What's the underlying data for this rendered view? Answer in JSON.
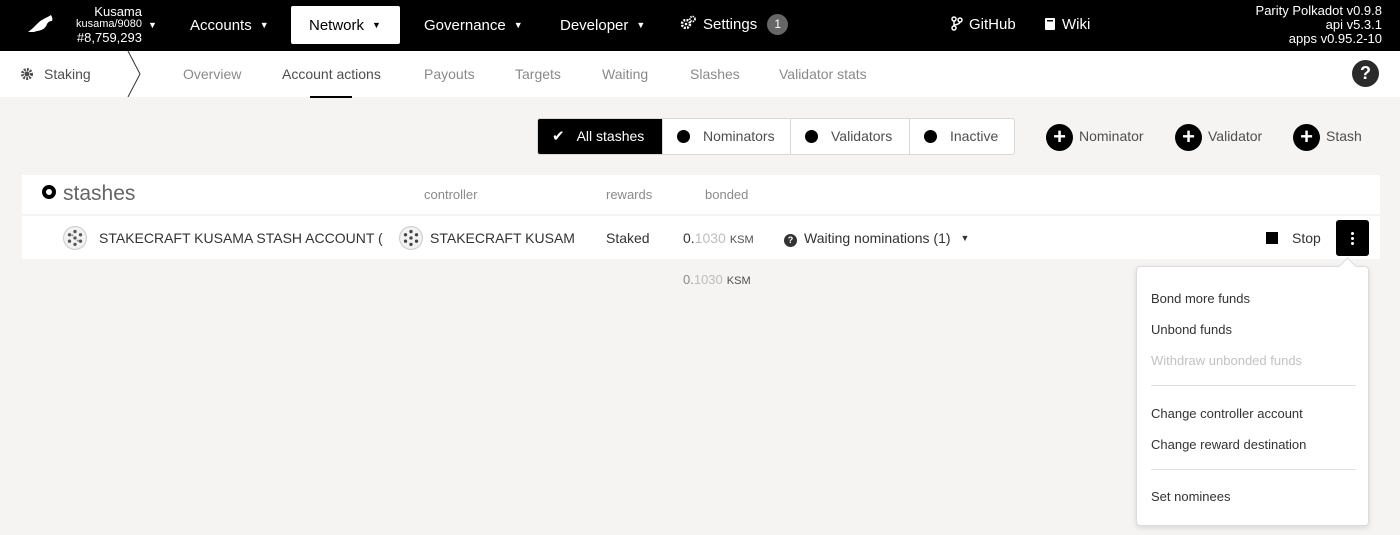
{
  "chain": {
    "name": "Kusama",
    "node": "kusama/9080",
    "block": "#8,759,293"
  },
  "menu": {
    "accounts": "Accounts",
    "network": "Network",
    "governance": "Governance",
    "developer": "Developer",
    "settings": "Settings",
    "settings_badge": "1",
    "github": "GitHub",
    "wiki": "Wiki"
  },
  "version": {
    "line1": "Parity Polkadot v0.9.8",
    "line2": "api v5.3.1",
    "line3": "apps v0.95.2-10"
  },
  "subnav": {
    "app": "Staking",
    "tabs": [
      "Overview",
      "Account actions",
      "Payouts",
      "Targets",
      "Waiting",
      "Slashes",
      "Validator stats"
    ],
    "help": "?"
  },
  "filters": [
    "All stashes",
    "Nominators",
    "Validators",
    "Inactive"
  ],
  "add_buttons": [
    "Nominator",
    "Validator",
    "Stash"
  ],
  "table": {
    "title": "stashes",
    "headers": {
      "controller": "controller",
      "rewards": "rewards",
      "bonded": "bonded"
    },
    "row": {
      "stash": "STAKECRAFT KUSAMA STASH ACCOUNT (",
      "controller": "STAKECRAFT KUSAM",
      "rewards": "Staked",
      "bonded_int": "0.",
      "bonded_dec": "1030",
      "unit": "KSM",
      "status": "Waiting nominations (1)",
      "stop": "Stop"
    },
    "total": {
      "int": "0.",
      "dec": "1030",
      "unit": "KSM"
    }
  },
  "dropdown": {
    "group1": [
      "Bond more funds",
      "Unbond funds",
      "Withdraw unbonded funds"
    ],
    "group2": [
      "Change controller account",
      "Change reward destination"
    ],
    "group3": [
      "Set nominees"
    ]
  }
}
